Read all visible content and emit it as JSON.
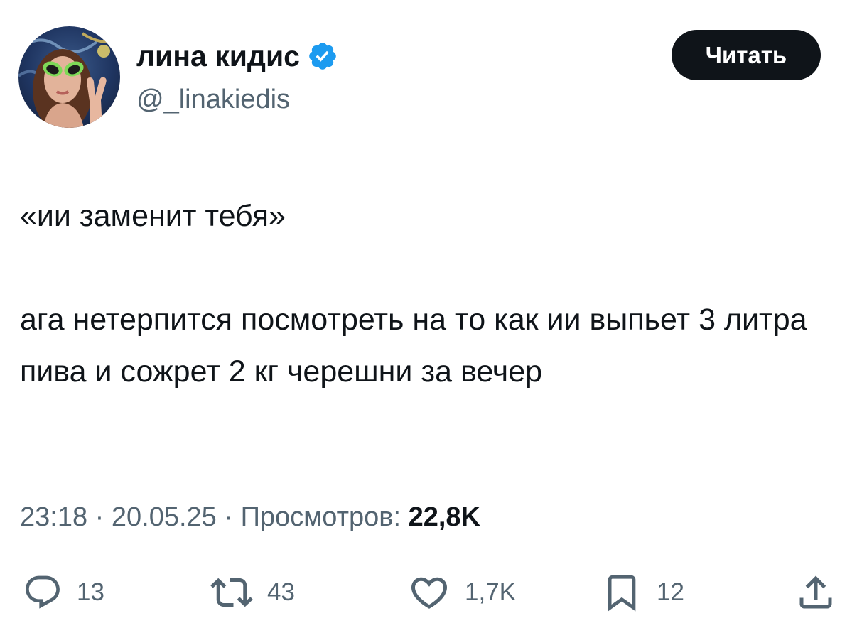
{
  "author": {
    "display_name": "лина кидис",
    "handle": "@_linakiedis",
    "verified": true
  },
  "follow_button": {
    "label": "Читать"
  },
  "tweet": {
    "text": "«ии заменит тебя»\n\nага нетерпится посмотреть на то как ии выпьет 3 литра пива и сожрет 2 кг черешни за вечер",
    "time": "23:18",
    "date": "20.05.25",
    "views_label": "Просмотров:",
    "views_count": "22,8K",
    "separator": " · "
  },
  "actions": {
    "replies": "13",
    "retweets": "43",
    "likes": "1,7K",
    "bookmarks": "12"
  },
  "colors": {
    "text": "#0f1419",
    "secondary": "#536471",
    "verified_blue": "#1d9bf0",
    "button_bg": "#0f1419"
  },
  "icons": [
    "verified-badge-icon",
    "reply-icon",
    "retweet-icon",
    "like-icon",
    "bookmark-icon",
    "share-icon"
  ]
}
